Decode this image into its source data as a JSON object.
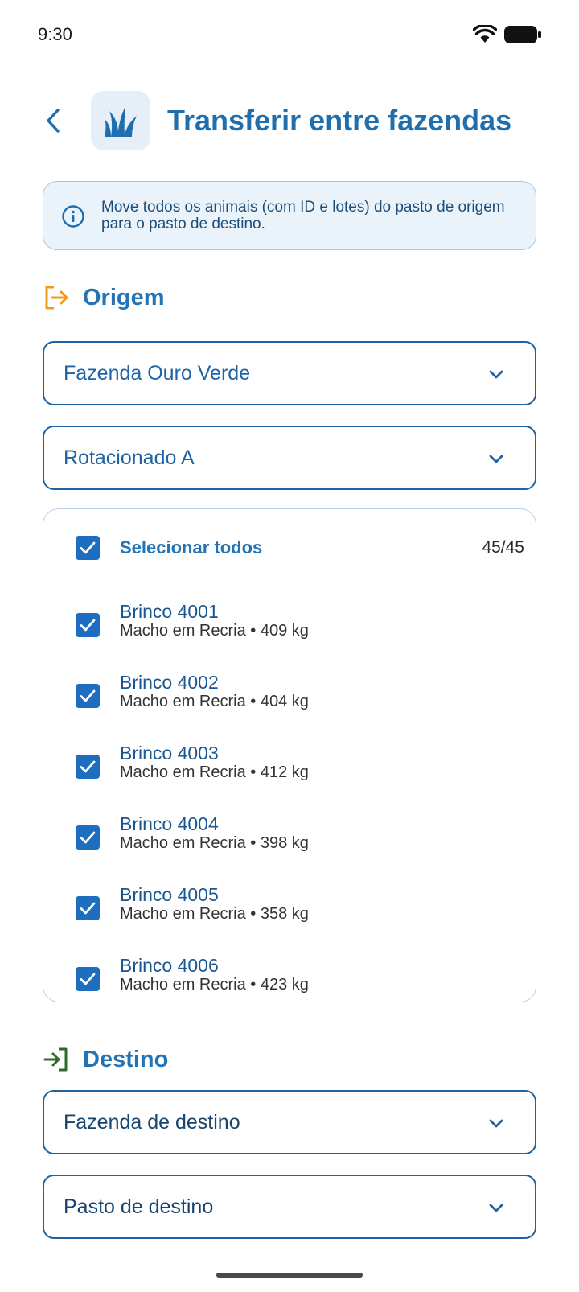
{
  "status_bar": {
    "time": "9:30"
  },
  "header": {
    "title": "Transferir entre fazendas"
  },
  "info": {
    "text": "Move todos os animais (com ID e lotes) do pasto de origem para o pasto de destino."
  },
  "origin": {
    "heading": "Origem",
    "farm": "Fazenda Ouro Verde",
    "pasture": "Rotacionado A",
    "select_all_label": "Selecionar todos",
    "select_count": "45/45",
    "animals": [
      {
        "name": "Brinco 4001",
        "detail": "Macho em Recria • 409 kg",
        "checked": true
      },
      {
        "name": "Brinco 4002",
        "detail": "Macho em Recria • 404 kg",
        "checked": true
      },
      {
        "name": "Brinco 4003",
        "detail": "Macho em Recria • 412 kg",
        "checked": true
      },
      {
        "name": "Brinco 4004",
        "detail": "Macho em Recria • 398 kg",
        "checked": true
      },
      {
        "name": "Brinco 4005",
        "detail": "Macho em Recria • 358 kg",
        "checked": true
      },
      {
        "name": "Brinco 4006",
        "detail": "Macho em Recria • 423 kg",
        "checked": true
      }
    ]
  },
  "destination": {
    "heading": "Destino",
    "farm_placeholder": "Fazenda de destino",
    "pasture_placeholder": "Pasto de destino"
  },
  "colors": {
    "primary": "#1f6fae",
    "checkbox": "#1f6dbe",
    "origin_icon": "#f29a1f",
    "destination_icon": "#2e6b2a"
  },
  "icons": {
    "back": "chevron-left-icon",
    "logo": "grass-icon",
    "info": "info-circle-icon",
    "origin": "logout-arrow-icon",
    "destination": "login-arrow-icon",
    "dropdown": "chevron-down-icon",
    "check": "check-icon"
  }
}
